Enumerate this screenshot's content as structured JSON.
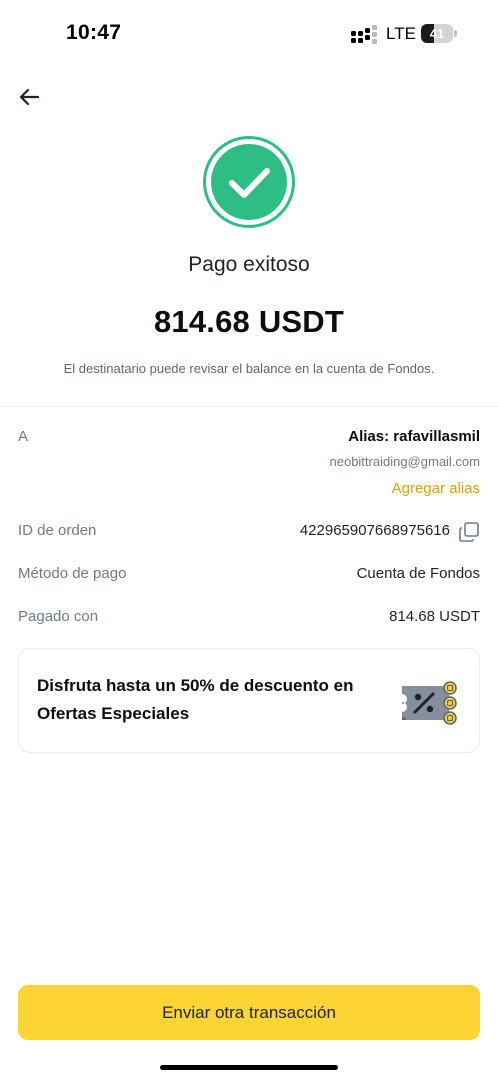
{
  "status_bar": {
    "time": "10:47",
    "network": "LTE",
    "battery_level": "41",
    "battery_fraction": 0.41
  },
  "result": {
    "title": "Pago exitoso",
    "amount": "814.68 USDT",
    "note": "El destinatario puede revisar el balance en la cuenta de Fondos."
  },
  "details": {
    "to_label": "A",
    "alias": "Alias: rafavillasmil",
    "email": "neobittraiding@gmail.com",
    "add_alias_label": "Agregar alias",
    "order_id_label": "ID de orden",
    "order_id": "422965907668975616",
    "payment_method_label": "Método de pago",
    "payment_method": "Cuenta de Fondos",
    "paid_with_label": "Pagado con",
    "paid_with": "814.68 USDT"
  },
  "promo": {
    "text": "Disfruta hasta un 50% de descuento en Ofertas Especiales",
    "icon": "discount-coupon-icon"
  },
  "actions": {
    "send_again_label": "Enviar otra transacción"
  },
  "colors": {
    "accent": "#fcd535",
    "success": "#2ebd85",
    "link": "#d9a400"
  }
}
